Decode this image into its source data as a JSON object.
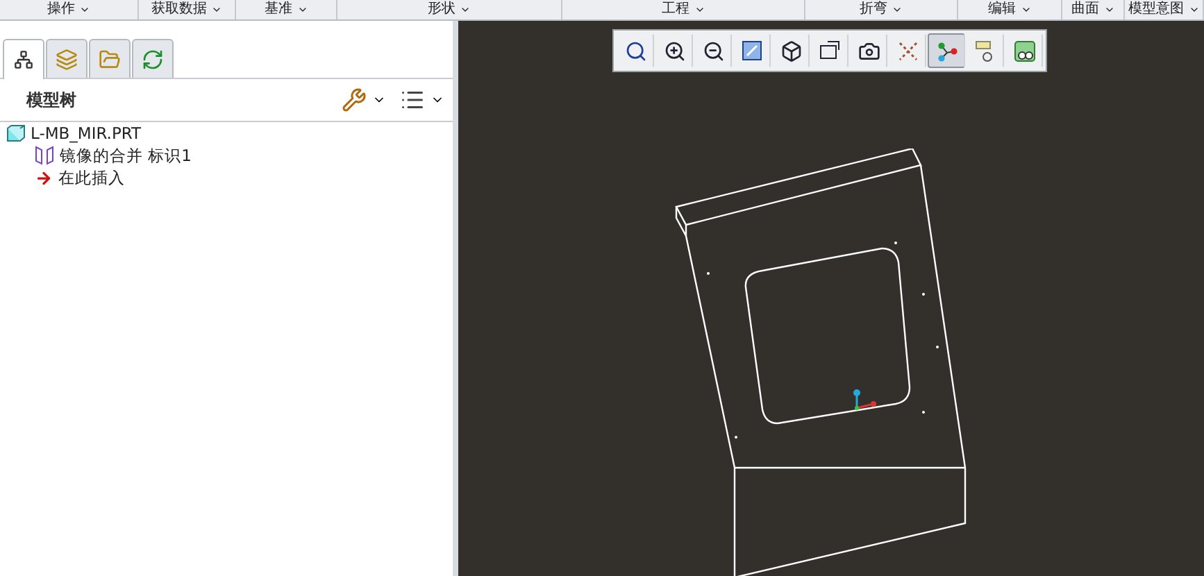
{
  "menu_groups": [
    {
      "label": "操作"
    },
    {
      "label": "获取数据"
    },
    {
      "label": "基准"
    },
    {
      "label": "形状"
    },
    {
      "label": "工程"
    },
    {
      "label": "折弯"
    },
    {
      "label": "编辑"
    },
    {
      "label": "曲面"
    },
    {
      "label": "模型意图"
    }
  ],
  "panel_tabs": [
    {
      "kind": "tree",
      "selected": true
    },
    {
      "kind": "layers",
      "selected": false
    },
    {
      "kind": "folder",
      "selected": false
    },
    {
      "kind": "web",
      "selected": false
    }
  ],
  "model_tree": {
    "title": "模型树",
    "items": [
      {
        "kind": "part",
        "label": "L-MB_MIR.PRT",
        "children": [
          {
            "kind": "feature",
            "label": "镜像的合并 标识1"
          },
          {
            "kind": "insert",
            "label": "在此插入"
          }
        ]
      }
    ]
  },
  "view_toolbar": [
    {
      "kind": "refit",
      "selected": false
    },
    {
      "kind": "zoom-in",
      "selected": false
    },
    {
      "kind": "zoom-out",
      "selected": false
    },
    {
      "kind": "repaint",
      "selected": false
    },
    {
      "kind": "display-style",
      "selected": false
    },
    {
      "kind": "saved-views",
      "selected": false
    },
    {
      "kind": "camera",
      "selected": false
    },
    {
      "kind": "datum",
      "selected": false
    },
    {
      "kind": "spin-center",
      "selected": true
    },
    {
      "kind": "annotation",
      "selected": false
    },
    {
      "kind": "appearance",
      "selected": false
    }
  ]
}
